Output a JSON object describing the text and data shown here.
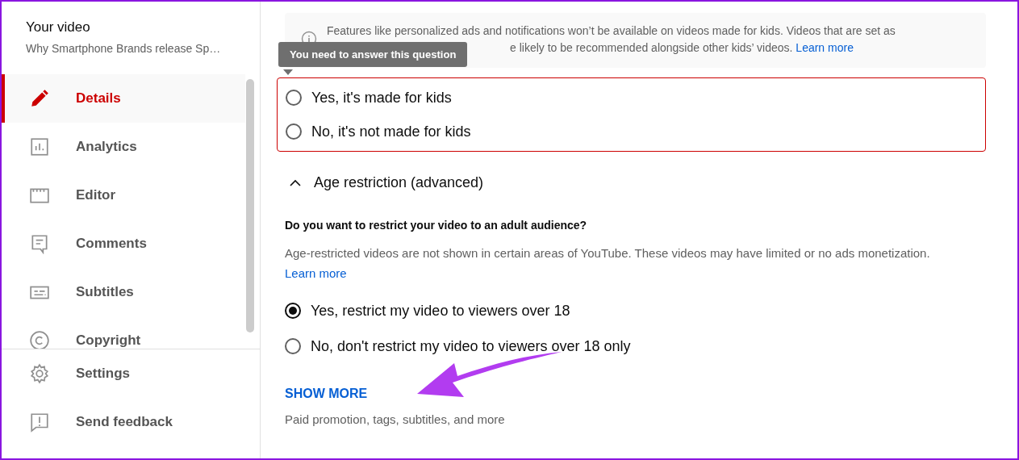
{
  "sidebar": {
    "title": "Your video",
    "subtitle": "Why Smartphone Brands release Sp…",
    "items": [
      {
        "kind": "pencil",
        "label": "Details",
        "selected": true
      },
      {
        "kind": "chart",
        "label": "Analytics",
        "selected": false
      },
      {
        "kind": "clapper",
        "label": "Editor",
        "selected": false
      },
      {
        "kind": "comment",
        "label": "Comments",
        "selected": false
      },
      {
        "kind": "subtitles",
        "label": "Subtitles",
        "selected": false
      },
      {
        "kind": "copyright",
        "label": "Copyright",
        "selected": false
      }
    ],
    "footer_items": [
      {
        "kind": "gear",
        "label": "Settings"
      },
      {
        "kind": "feedback",
        "label": "Send feedback"
      }
    ]
  },
  "made_for_kids": {
    "info_line_1": "Features like personalized ads and notifications won’t be available on videos made for kids. Videos that are set as",
    "info_line_2": "e likely to be recommended alongside other kids’ videos.",
    "info_link": "Learn more",
    "tooltip": "You need to answer this question",
    "error": true,
    "options": [
      {
        "label": "Yes, it's made for kids",
        "selected": false
      },
      {
        "label": "No, it's not made for kids",
        "selected": false
      }
    ]
  },
  "age_restriction": {
    "title": "Age restriction (advanced)",
    "expanded": true,
    "question": "Do you want to restrict your video to an adult audience?",
    "description": "Age-restricted videos are not shown in certain areas of YouTube. These videos may have limited or no ads monetization.",
    "link": "Learn more",
    "options": [
      {
        "label": "Yes, restrict my video to viewers over 18",
        "selected": true
      },
      {
        "label": "No, don't restrict my video to viewers over 18 only",
        "selected": false
      }
    ]
  },
  "show_more": {
    "label": "SHOW MORE",
    "hint": "Paid promotion, tags, subtitles, and more"
  }
}
